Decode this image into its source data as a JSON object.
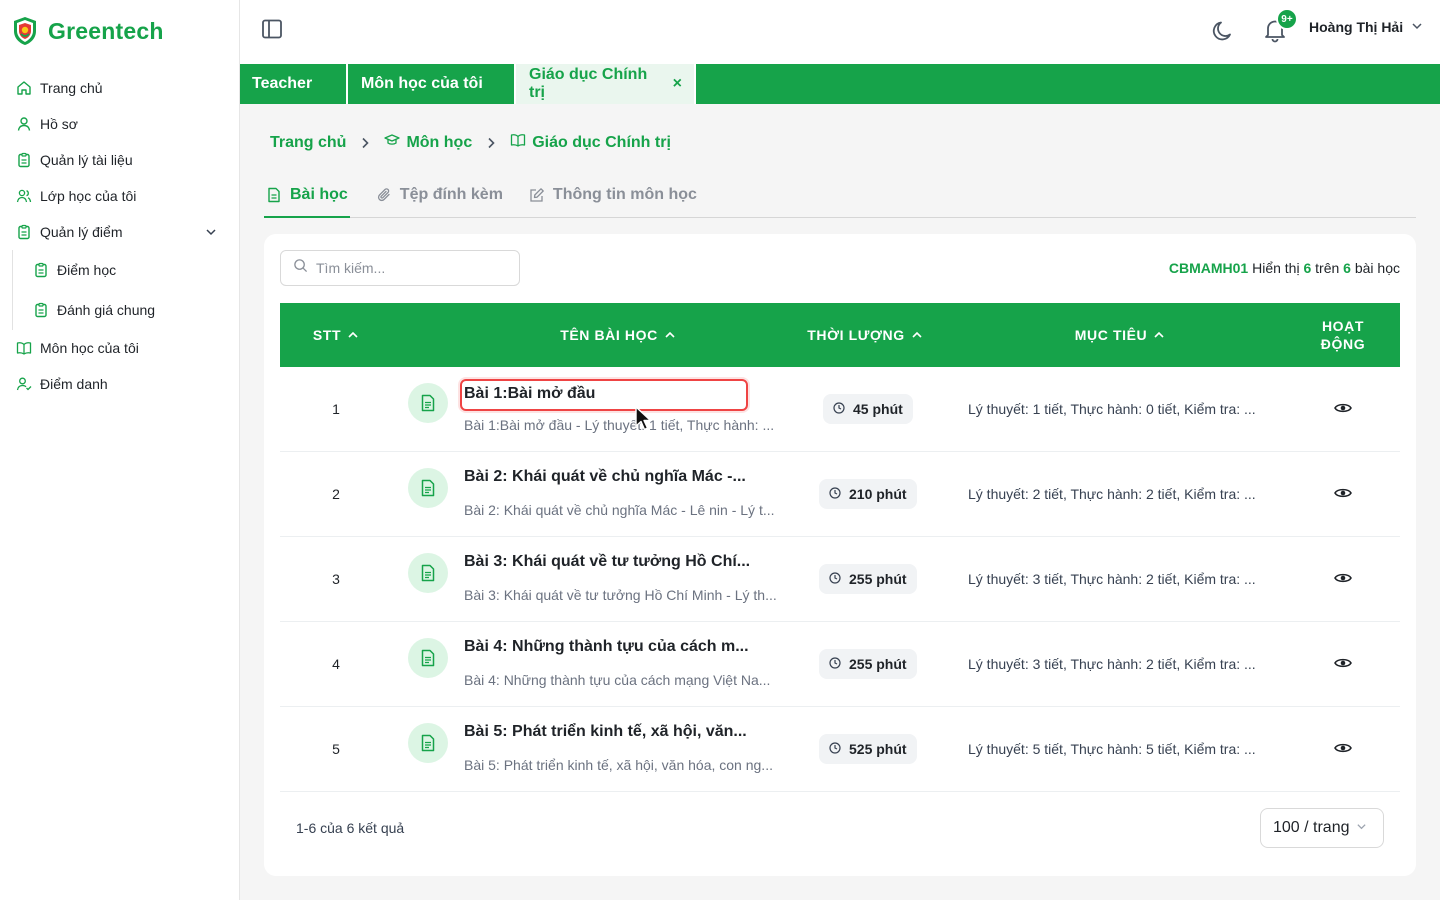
{
  "brand": {
    "name": "Greentech",
    "color": "#16a34a"
  },
  "sidebar": {
    "items": [
      {
        "label": "Trang chủ",
        "icon": "home-icon"
      },
      {
        "label": "Hồ sơ",
        "icon": "user-icon"
      },
      {
        "label": "Quản lý tài liệu",
        "icon": "clipboard-icon"
      },
      {
        "label": "Lớp học của tôi",
        "icon": "users-icon"
      },
      {
        "label": "Quản lý điểm",
        "icon": "clipboard-icon",
        "expanded": true,
        "children": [
          {
            "label": "Điểm học"
          },
          {
            "label": "Đánh giá chung"
          }
        ]
      },
      {
        "label": "Môn học của tôi",
        "icon": "book-icon"
      },
      {
        "label": "Điểm danh",
        "icon": "user-check-icon"
      }
    ]
  },
  "header": {
    "notification_badge": "9+",
    "user_name": "Hoàng Thị Hải"
  },
  "tabs": [
    {
      "label": "Teacher"
    },
    {
      "label": "Môn học của tôi"
    },
    {
      "label": "Giáo dục Chính trị",
      "active": true,
      "close": "×"
    }
  ],
  "breadcrumb": [
    {
      "label": "Trang chủ"
    },
    {
      "label": "Môn học",
      "icon": "graduation-cap-icon"
    },
    {
      "label": "Giáo dục Chính trị",
      "icon": "book-open-icon"
    }
  ],
  "content_tabs": [
    {
      "label": "Bài học",
      "active": true,
      "icon": "file-text-icon"
    },
    {
      "label": "Tệp đính kèm",
      "icon": "paperclip-icon"
    },
    {
      "label": "Thông tin môn học",
      "icon": "edit-icon"
    }
  ],
  "search": {
    "placeholder": "Tìm kiếm..."
  },
  "summary": {
    "code": "CBMAMH01",
    "prefix": "Hiển thị",
    "shown": "6",
    "middle": "trên",
    "total": "6",
    "suffix": "bài học"
  },
  "table": {
    "headers": {
      "stt": "STT",
      "name": "TÊN BÀI HỌC",
      "duration": "THỜI LƯỢNG",
      "goal": "MỤC TIÊU",
      "action_1": "HOẠT",
      "action_2": "ĐỘNG"
    },
    "rows": [
      {
        "stt": "1",
        "title": "Bài 1:Bài mở đầu",
        "subtitle": "Bài 1:Bài mở đầu - Lý thuyết: 1 tiết, Thực hành: ...",
        "duration": "45 phút",
        "goal": "Lý thuyết: 1 tiết, Thực hành: 0 tiết, Kiểm tra: ..."
      },
      {
        "stt": "2",
        "title": "Bài 2: Khái quát về chủ nghĩa Mác -...",
        "subtitle": "Bài 2: Khái quát về chủ nghĩa Mác - Lê nin - Lý t...",
        "duration": "210 phút",
        "goal": "Lý thuyết: 2 tiết, Thực hành: 2 tiết, Kiểm tra: ..."
      },
      {
        "stt": "3",
        "title": "Bài 3: Khái quát về tư tưởng Hồ Chí...",
        "subtitle": "Bài 3: Khái quát về tư tưởng Hồ Chí Minh - Lý th...",
        "duration": "255 phút",
        "goal": "Lý thuyết: 3 tiết, Thực hành: 2 tiết, Kiểm tra: ..."
      },
      {
        "stt": "4",
        "title": "Bài 4: Những thành tựu của cách m...",
        "subtitle": "Bài 4: Những thành tựu của cách mạng Việt Na...",
        "duration": "255 phút",
        "goal": "Lý thuyết: 3 tiết, Thực hành: 2 tiết, Kiểm tra: ..."
      },
      {
        "stt": "5",
        "title": "Bài 5: Phát triển kinh tế, xã hội, văn...",
        "subtitle": "Bài 5: Phát triển kinh tế, xã hội, văn hóa, con ng...",
        "duration": "525 phút",
        "goal": "Lý thuyết: 5 tiết, Thực hành: 5 tiết, Kiểm tra: ..."
      }
    ]
  },
  "footer": {
    "result_text": "1-6 của 6 kết quả",
    "page_size": "100 / trang"
  }
}
